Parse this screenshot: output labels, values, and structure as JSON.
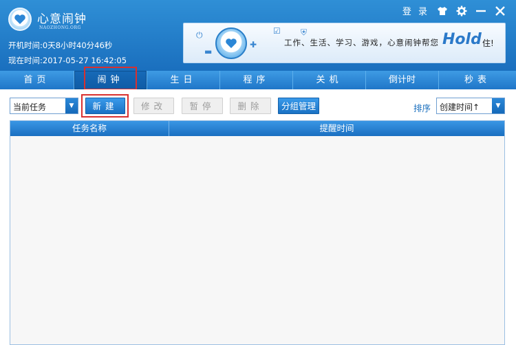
{
  "app": {
    "title": "心意闹钟",
    "subtitle": "NAOZHONG.ORG",
    "uptime_label": "开机时间:",
    "uptime_value": "0天8小时40分46秒",
    "now_label": "现在时间:",
    "now_value": "2017-05-27 16:42:05"
  },
  "window_controls": {
    "login": "登 录",
    "icons": [
      "shirt-icon",
      "gear-icon",
      "minimize-icon",
      "close-icon"
    ]
  },
  "banner": {
    "text": "工作、生活、学习、游戏，心意闹钟帮您",
    "hold": "Hold",
    "tail": "住!"
  },
  "nav": {
    "items": [
      {
        "label": "首页"
      },
      {
        "label": "闹钟"
      },
      {
        "label": "生日"
      },
      {
        "label": "程序"
      },
      {
        "label": "关机"
      },
      {
        "label": "倒计时"
      },
      {
        "label": "秒表"
      }
    ],
    "active_index": 1
  },
  "toolbar": {
    "filter_value": "当前任务",
    "new_label": "新建",
    "edit_label": "修改",
    "pause_label": "暂停",
    "delete_label": "删除",
    "group_label": "分组管理",
    "sort_label": "排序",
    "sort_value": "创建时间↑"
  },
  "table": {
    "columns": [
      "任务名称",
      "提醒时间"
    ],
    "rows": []
  },
  "colors": {
    "header_blue": "#1a6fbe",
    "highlight_red": "#d9302f"
  }
}
